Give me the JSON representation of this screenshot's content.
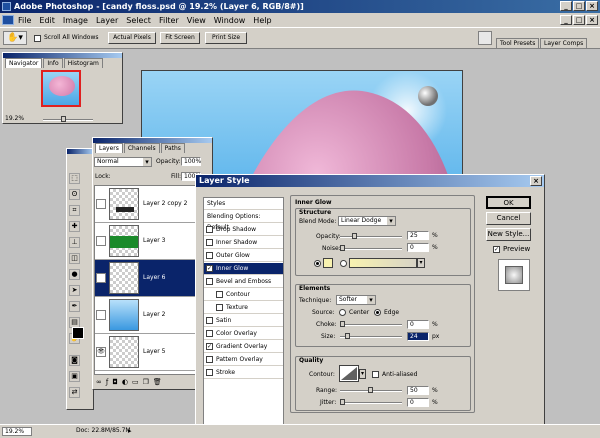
{
  "app": {
    "title": "Adobe Photoshop - [candy floss.psd @ 19.2% (Layer 6, RGB/8#)]",
    "window_buttons": [
      "_",
      "□",
      "×"
    ]
  },
  "menu": [
    "File",
    "Edit",
    "Image",
    "Layer",
    "Select",
    "Filter",
    "View",
    "Window",
    "Help"
  ],
  "options_bar": {
    "scroll_all_windows": "Scroll All Windows",
    "actual_pixels": "Actual Pixels",
    "fit_screen": "Fit Screen",
    "print_size": "Print Size",
    "tool_presets": "Tool Presets",
    "layer_comps": "Layer Comps"
  },
  "navigator": {
    "tabs": [
      "Navigator",
      "Info",
      "Histogram"
    ],
    "zoom": "19.2%"
  },
  "layers_panel": {
    "tabs": [
      "Layers",
      "Channels",
      "Paths"
    ],
    "blend_mode": "Normal",
    "opacity_label": "Opacity:",
    "opacity": "100%",
    "lock_label": "Lock:",
    "fill_label": "Fill:",
    "fill": "100%",
    "layers": [
      {
        "name": "Layer 2 copy 2",
        "visible": false
      },
      {
        "name": "Layer 3",
        "visible": false
      },
      {
        "name": "Layer 6",
        "visible": true,
        "selected": true
      },
      {
        "name": "Layer 2",
        "visible": false
      },
      {
        "name": "Layer 5",
        "visible": true
      }
    ]
  },
  "dialog": {
    "title": "Layer Style",
    "styles_header": "Styles",
    "blending_options": "Blending Options: Default",
    "style_items": [
      {
        "label": "Drop Shadow",
        "checked": false
      },
      {
        "label": "Inner Shadow",
        "checked": false
      },
      {
        "label": "Outer Glow",
        "checked": false
      },
      {
        "label": "Inner Glow",
        "checked": true,
        "selected": true
      },
      {
        "label": "Bevel and Emboss",
        "checked": false
      },
      {
        "label": "Contour",
        "checked": false
      },
      {
        "label": "Texture",
        "checked": false
      },
      {
        "label": "Satin",
        "checked": false
      },
      {
        "label": "Color Overlay",
        "checked": false
      },
      {
        "label": "Gradient Overlay",
        "checked": true
      },
      {
        "label": "Pattern Overlay",
        "checked": false
      },
      {
        "label": "Stroke",
        "checked": false
      }
    ],
    "section_title": "Inner Glow",
    "structure": {
      "title": "Structure",
      "blend_mode_label": "Blend Mode:",
      "blend_mode": "Linear Dodge",
      "opacity_label": "Opacity:",
      "opacity": "25",
      "noise_label": "Noise:",
      "noise": "0",
      "pct": "%"
    },
    "elements": {
      "title": "Elements",
      "technique_label": "Technique:",
      "technique": "Softer",
      "source_label": "Source:",
      "center": "Center",
      "edge": "Edge",
      "choke_label": "Choke:",
      "choke": "0",
      "size_label": "Size:",
      "size": "24",
      "px": "px",
      "pct": "%"
    },
    "quality": {
      "title": "Quality",
      "contour_label": "Contour:",
      "anti_aliased": "Anti-aliased",
      "range_label": "Range:",
      "range": "50",
      "jitter_label": "Jitter:",
      "jitter": "0",
      "pct": "%"
    },
    "buttons": {
      "ok": "OK",
      "cancel": "Cancel",
      "new_style": "New Style...",
      "preview": "Preview"
    },
    "glow_color": "#f8f2b0"
  },
  "status": {
    "zoom": "19.2%",
    "doc": "Doc: 22.8M/85.7M"
  }
}
